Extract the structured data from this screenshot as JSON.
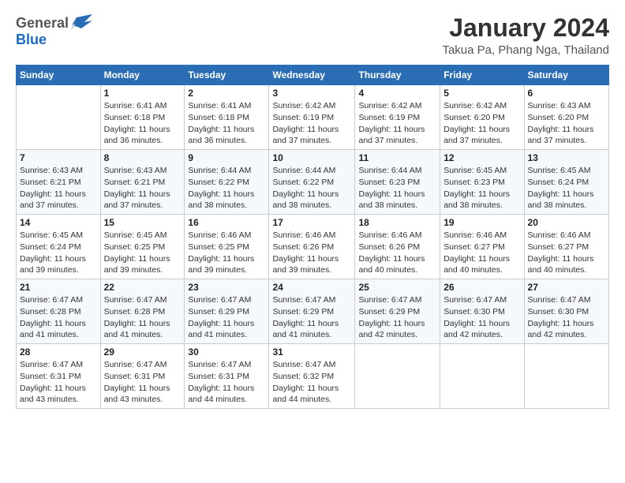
{
  "logo": {
    "general": "General",
    "blue": "Blue"
  },
  "header": {
    "month": "January 2024",
    "location": "Takua Pa, Phang Nga, Thailand"
  },
  "weekdays": [
    "Sunday",
    "Monday",
    "Tuesday",
    "Wednesday",
    "Thursday",
    "Friday",
    "Saturday"
  ],
  "weeks": [
    [
      {
        "day": "",
        "detail": ""
      },
      {
        "day": "1",
        "detail": "Sunrise: 6:41 AM\nSunset: 6:18 PM\nDaylight: 11 hours\nand 36 minutes."
      },
      {
        "day": "2",
        "detail": "Sunrise: 6:41 AM\nSunset: 6:18 PM\nDaylight: 11 hours\nand 36 minutes."
      },
      {
        "day": "3",
        "detail": "Sunrise: 6:42 AM\nSunset: 6:19 PM\nDaylight: 11 hours\nand 37 minutes."
      },
      {
        "day": "4",
        "detail": "Sunrise: 6:42 AM\nSunset: 6:19 PM\nDaylight: 11 hours\nand 37 minutes."
      },
      {
        "day": "5",
        "detail": "Sunrise: 6:42 AM\nSunset: 6:20 PM\nDaylight: 11 hours\nand 37 minutes."
      },
      {
        "day": "6",
        "detail": "Sunrise: 6:43 AM\nSunset: 6:20 PM\nDaylight: 11 hours\nand 37 minutes."
      }
    ],
    [
      {
        "day": "7",
        "detail": "Sunrise: 6:43 AM\nSunset: 6:21 PM\nDaylight: 11 hours\nand 37 minutes."
      },
      {
        "day": "8",
        "detail": "Sunrise: 6:43 AM\nSunset: 6:21 PM\nDaylight: 11 hours\nand 37 minutes."
      },
      {
        "day": "9",
        "detail": "Sunrise: 6:44 AM\nSunset: 6:22 PM\nDaylight: 11 hours\nand 38 minutes."
      },
      {
        "day": "10",
        "detail": "Sunrise: 6:44 AM\nSunset: 6:22 PM\nDaylight: 11 hours\nand 38 minutes."
      },
      {
        "day": "11",
        "detail": "Sunrise: 6:44 AM\nSunset: 6:23 PM\nDaylight: 11 hours\nand 38 minutes."
      },
      {
        "day": "12",
        "detail": "Sunrise: 6:45 AM\nSunset: 6:23 PM\nDaylight: 11 hours\nand 38 minutes."
      },
      {
        "day": "13",
        "detail": "Sunrise: 6:45 AM\nSunset: 6:24 PM\nDaylight: 11 hours\nand 38 minutes."
      }
    ],
    [
      {
        "day": "14",
        "detail": "Sunrise: 6:45 AM\nSunset: 6:24 PM\nDaylight: 11 hours\nand 39 minutes."
      },
      {
        "day": "15",
        "detail": "Sunrise: 6:45 AM\nSunset: 6:25 PM\nDaylight: 11 hours\nand 39 minutes."
      },
      {
        "day": "16",
        "detail": "Sunrise: 6:46 AM\nSunset: 6:25 PM\nDaylight: 11 hours\nand 39 minutes."
      },
      {
        "day": "17",
        "detail": "Sunrise: 6:46 AM\nSunset: 6:26 PM\nDaylight: 11 hours\nand 39 minutes."
      },
      {
        "day": "18",
        "detail": "Sunrise: 6:46 AM\nSunset: 6:26 PM\nDaylight: 11 hours\nand 40 minutes."
      },
      {
        "day": "19",
        "detail": "Sunrise: 6:46 AM\nSunset: 6:27 PM\nDaylight: 11 hours\nand 40 minutes."
      },
      {
        "day": "20",
        "detail": "Sunrise: 6:46 AM\nSunset: 6:27 PM\nDaylight: 11 hours\nand 40 minutes."
      }
    ],
    [
      {
        "day": "21",
        "detail": "Sunrise: 6:47 AM\nSunset: 6:28 PM\nDaylight: 11 hours\nand 41 minutes."
      },
      {
        "day": "22",
        "detail": "Sunrise: 6:47 AM\nSunset: 6:28 PM\nDaylight: 11 hours\nand 41 minutes."
      },
      {
        "day": "23",
        "detail": "Sunrise: 6:47 AM\nSunset: 6:29 PM\nDaylight: 11 hours\nand 41 minutes."
      },
      {
        "day": "24",
        "detail": "Sunrise: 6:47 AM\nSunset: 6:29 PM\nDaylight: 11 hours\nand 41 minutes."
      },
      {
        "day": "25",
        "detail": "Sunrise: 6:47 AM\nSunset: 6:29 PM\nDaylight: 11 hours\nand 42 minutes."
      },
      {
        "day": "26",
        "detail": "Sunrise: 6:47 AM\nSunset: 6:30 PM\nDaylight: 11 hours\nand 42 minutes."
      },
      {
        "day": "27",
        "detail": "Sunrise: 6:47 AM\nSunset: 6:30 PM\nDaylight: 11 hours\nand 42 minutes."
      }
    ],
    [
      {
        "day": "28",
        "detail": "Sunrise: 6:47 AM\nSunset: 6:31 PM\nDaylight: 11 hours\nand 43 minutes."
      },
      {
        "day": "29",
        "detail": "Sunrise: 6:47 AM\nSunset: 6:31 PM\nDaylight: 11 hours\nand 43 minutes."
      },
      {
        "day": "30",
        "detail": "Sunrise: 6:47 AM\nSunset: 6:31 PM\nDaylight: 11 hours\nand 44 minutes."
      },
      {
        "day": "31",
        "detail": "Sunrise: 6:47 AM\nSunset: 6:32 PM\nDaylight: 11 hours\nand 44 minutes."
      },
      {
        "day": "",
        "detail": ""
      },
      {
        "day": "",
        "detail": ""
      },
      {
        "day": "",
        "detail": ""
      }
    ]
  ]
}
